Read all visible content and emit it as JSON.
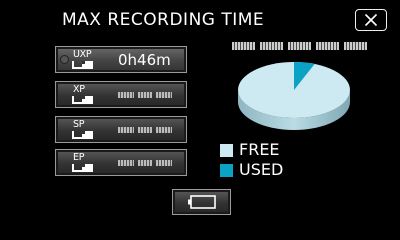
{
  "header": {
    "title": "MAX RECORDING TIME",
    "close_icon": "close-x-icon"
  },
  "modes": [
    {
      "label": "UXP",
      "value": "0h46m",
      "selected": true,
      "icon": "sd-card-icon"
    },
    {
      "label": "XP",
      "value": "",
      "selected": false,
      "icon": "sd-card-icon"
    },
    {
      "label": "SP",
      "value": "",
      "selected": false,
      "icon": "sd-card-icon"
    },
    {
      "label": "EP",
      "value": "",
      "selected": false,
      "icon": "sd-card-icon"
    }
  ],
  "usage_chart": {
    "type": "pie",
    "used_fraction": 0.06,
    "free_color": "#cdeaf2",
    "used_color": "#0aa3c6"
  },
  "legend": {
    "free_label": "FREE",
    "used_label": "USED"
  },
  "footer": {
    "battery_icon": "battery-icon"
  }
}
